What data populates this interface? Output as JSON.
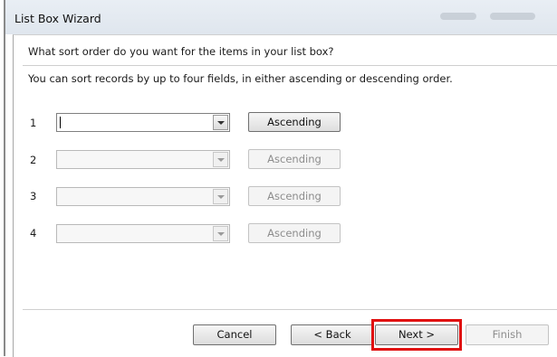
{
  "window": {
    "title": "List Box Wizard"
  },
  "wizard": {
    "question": "What sort order do you want for the items in your list box?",
    "instruction": "You can sort records by up to four fields, in either ascending or descending order.",
    "rows": [
      {
        "number": "1",
        "field_value": "",
        "sort_label": "Ascending",
        "enabled": true
      },
      {
        "number": "2",
        "field_value": "",
        "sort_label": "Ascending",
        "enabled": false
      },
      {
        "number": "3",
        "field_value": "",
        "sort_label": "Ascending",
        "enabled": false
      },
      {
        "number": "4",
        "field_value": "",
        "sort_label": "Ascending",
        "enabled": false
      }
    ]
  },
  "buttons": {
    "cancel": "Cancel",
    "back": "< Back",
    "next": "Next >",
    "finish": "Finish"
  },
  "colors": {
    "highlight": "#e01010"
  }
}
